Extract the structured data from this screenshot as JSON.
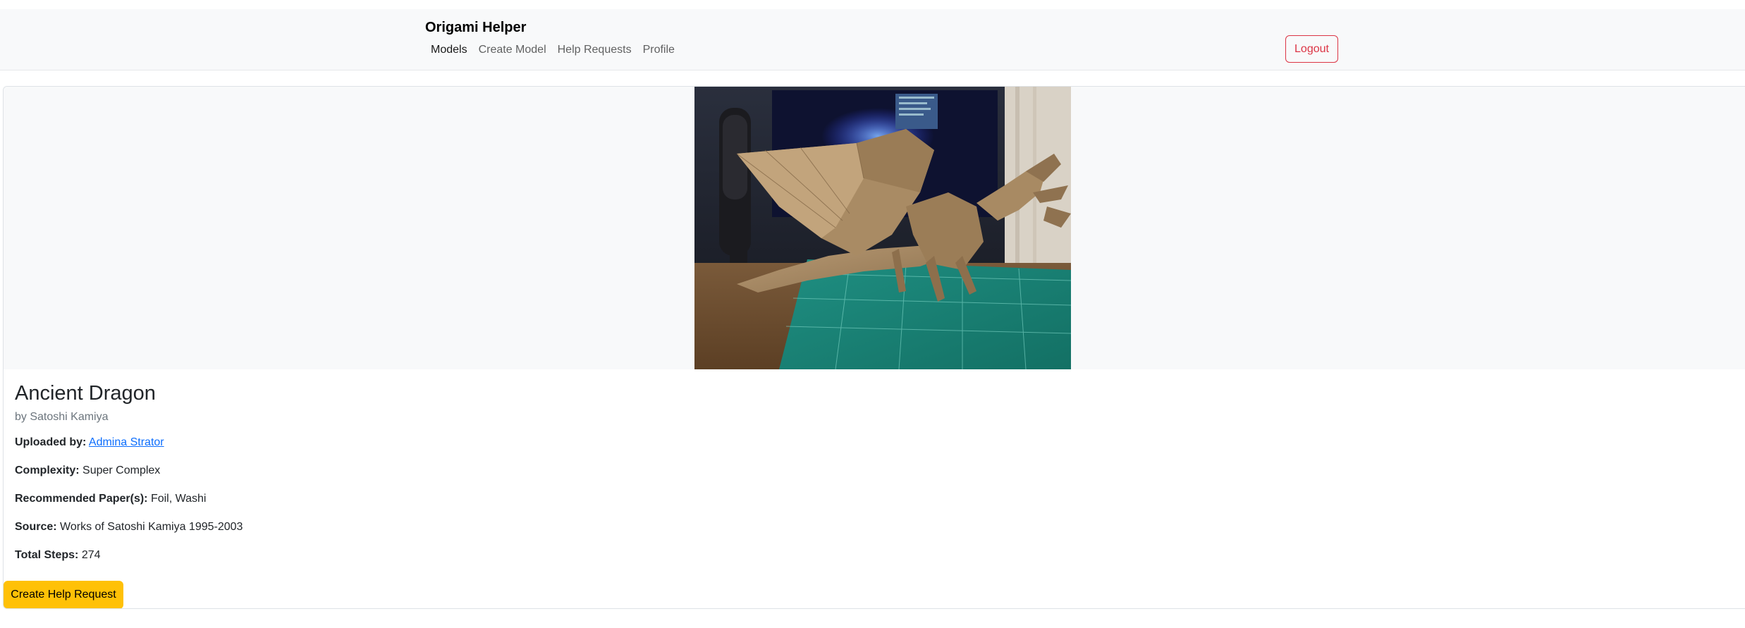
{
  "nav": {
    "brand": "Origami Helper",
    "links": [
      "Models",
      "Create Model",
      "Help Requests",
      "Profile"
    ],
    "active_link": "Models",
    "logout_label": "Logout"
  },
  "model": {
    "image_alt": "Origami ancient dragon model on a cutting mat",
    "title": "Ancient Dragon",
    "author": "by Satoshi Kamiya",
    "uploaded_by_label": "Uploaded by:",
    "uploaded_by": "Admina Strator",
    "complexity_label": "Complexity:",
    "complexity": "Super Complex",
    "paper_label": "Recommended Paper(s):",
    "paper": "Foil, Washi",
    "source_label": "Source:",
    "source": "Works of Satoshi Kamiya 1995-2003",
    "steps_label": "Total Steps:",
    "steps": "274",
    "help_button_label": "Create Help Request"
  },
  "colors": {
    "navbar_bg": "#f8f9fa",
    "logout": "#dc3545",
    "help_button": "#ffc107",
    "link": "#0d6efd"
  }
}
